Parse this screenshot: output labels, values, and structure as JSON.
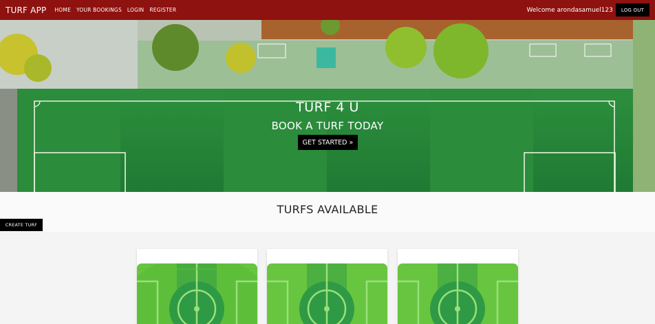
{
  "nav": {
    "brand": "TURF APP",
    "links": [
      "HOME",
      "YOUR BOOKINGS",
      "LOGIN",
      "REGISTER"
    ],
    "welcome": "Welcome arondasamuel123",
    "logout": "LOG OUT"
  },
  "hero": {
    "title": "TURF 4 U",
    "subtitle": "BOOK A TURF TODAY",
    "cta": "GET STARTED »"
  },
  "section": {
    "title": "TURFS AVAILABLE",
    "create_button": "CREATE TURF"
  },
  "colors": {
    "nav_bg": "#8e120f",
    "button_bg": "#000000",
    "pitch_green": "#2f9a45"
  },
  "cards": [
    {
      "image": "football-pitch-image"
    },
    {
      "image": "football-pitch-image"
    },
    {
      "image": "football-pitch-image"
    }
  ]
}
